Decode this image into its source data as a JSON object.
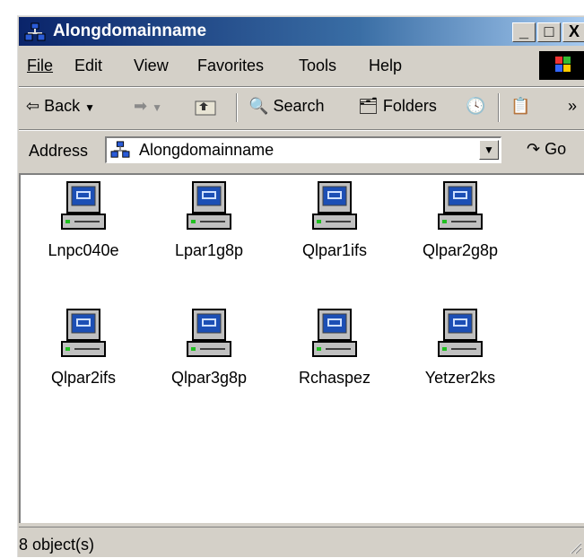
{
  "window": {
    "title": "Alongdomainname"
  },
  "titlebar": {
    "minimize_label": "_",
    "maximize_label": "□",
    "close_label": "X"
  },
  "menu": [
    {
      "label": "File"
    },
    {
      "label": "Edit"
    },
    {
      "label": "View"
    },
    {
      "label": "Favorites"
    },
    {
      "label": "Tools"
    },
    {
      "label": "Help"
    }
  ],
  "toolbar": {
    "back_label": "Back",
    "search_label": "Search",
    "folders_label": "Folders",
    "chevron": "»"
  },
  "address": {
    "label": "Address",
    "value": "Alongdomainname",
    "go_label": "Go"
  },
  "items": [
    {
      "label": "Lnpc040e",
      "icon": "computer-icon"
    },
    {
      "label": "Lpar1g8p",
      "icon": "computer-icon"
    },
    {
      "label": "Qlpar1ifs",
      "icon": "computer-icon"
    },
    {
      "label": "Qlpar2g8p",
      "icon": "computer-icon"
    },
    {
      "label": "Qlpar2ifs",
      "icon": "computer-icon"
    },
    {
      "label": "Qlpar3g8p",
      "icon": "computer-icon"
    },
    {
      "label": "Rchaspez",
      "icon": "computer-icon"
    },
    {
      "label": "Yetzer2ks",
      "icon": "computer-icon"
    }
  ],
  "status": {
    "text": "8 object(s)"
  },
  "colors": {
    "title_start": "#0a246a",
    "title_end": "#a6caf0",
    "chrome": "#d4d0c8",
    "screen": "#1c4fb5"
  }
}
